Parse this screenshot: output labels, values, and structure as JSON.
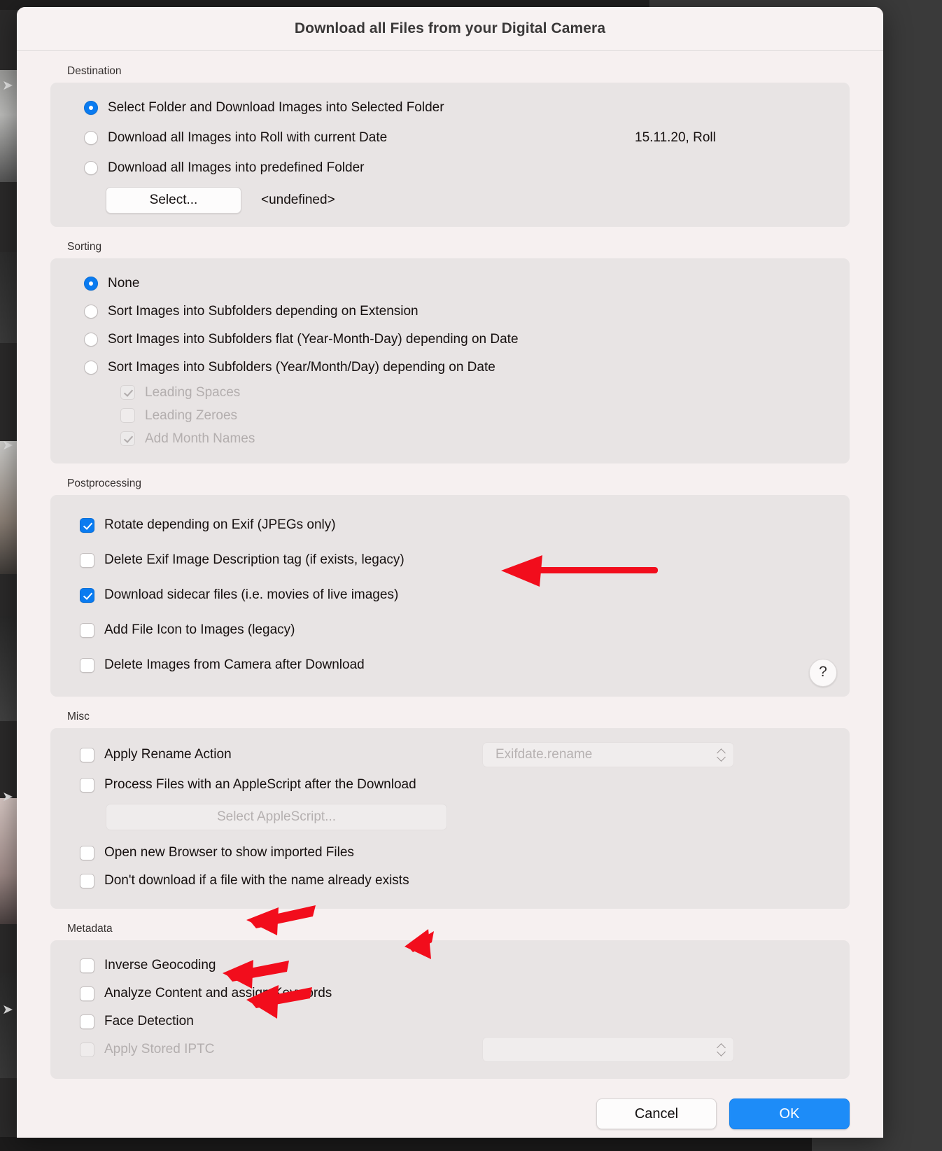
{
  "window": {
    "title": "Download all Files from your Digital Camera"
  },
  "sections": {
    "destination": {
      "label": "Destination",
      "options": [
        "Select Folder and Download Images into Selected Folder",
        "Download all Images into Roll with current Date",
        "Download all Images into predefined Folder"
      ],
      "selected_index": 0,
      "roll_value": "15.11.20, Roll",
      "select_button": "Select...",
      "folder_value": "<undefined>"
    },
    "sorting": {
      "label": "Sorting",
      "options": [
        "None",
        "Sort Images into Subfolders depending on Extension",
        "Sort Images into Subfolders flat (Year-Month-Day) depending on Date",
        "Sort Images into Subfolders (Year/Month/Day) depending on Date"
      ],
      "selected_index": 0,
      "suboptions": [
        {
          "label": "Leading Spaces",
          "checked": true,
          "disabled": true
        },
        {
          "label": "Leading Zeroes",
          "checked": false,
          "disabled": true
        },
        {
          "label": "Add Month Names",
          "checked": true,
          "disabled": true
        }
      ]
    },
    "postprocessing": {
      "label": "Postprocessing",
      "items": [
        {
          "label": "Rotate depending on Exif (JPEGs only)",
          "checked": true
        },
        {
          "label": "Delete Exif Image Description tag (if exists, legacy)",
          "checked": false
        },
        {
          "label": "Download sidecar files (i.e. movies of live images)",
          "checked": true
        },
        {
          "label": "Add File Icon to Images (legacy)",
          "checked": false
        },
        {
          "label": "Delete Images from Camera after Download",
          "checked": false
        }
      ],
      "help_icon": "question-mark-icon",
      "help_label": "?"
    },
    "misc": {
      "label": "Misc",
      "rename": {
        "label": "Apply Rename Action",
        "checked": false,
        "popup_value": "Exifdate.rename"
      },
      "applescript": {
        "label": "Process Files with an AppleScript after the Download",
        "checked": false,
        "button": "Select AppleScript..."
      },
      "items": [
        {
          "label": "Open new Browser to show imported Files",
          "checked": false
        },
        {
          "label": "Don't download if a file with the name already exists",
          "checked": false
        }
      ]
    },
    "metadata": {
      "label": "Metadata",
      "items": [
        {
          "label": "Inverse Geocoding",
          "checked": false,
          "disabled": false
        },
        {
          "label": "Analyze Content and assign Keywords",
          "checked": false,
          "disabled": false
        },
        {
          "label": "Face Detection",
          "checked": false,
          "disabled": false
        },
        {
          "label": "Apply Stored IPTC",
          "checked": false,
          "disabled": true
        }
      ],
      "iptc_popup_value": ""
    }
  },
  "footer": {
    "cancel": "Cancel",
    "ok": "OK"
  },
  "annotations": {
    "accent_color": "#f20d1c",
    "arrow_targets": [
      "Download sidecar files (i.e. movies of live images)",
      "Inverse Geocoding",
      "Analyze Content and assign Keywords",
      "Face Detection",
      "Apply Stored IPTC"
    ]
  },
  "colors": {
    "dialog_background": "#f6f0f0",
    "group_background": "#e8e4e4",
    "accent_blue": "#0a7bf0",
    "ok_button": "#1d8cf8",
    "desktop": "#3a3a3a"
  }
}
